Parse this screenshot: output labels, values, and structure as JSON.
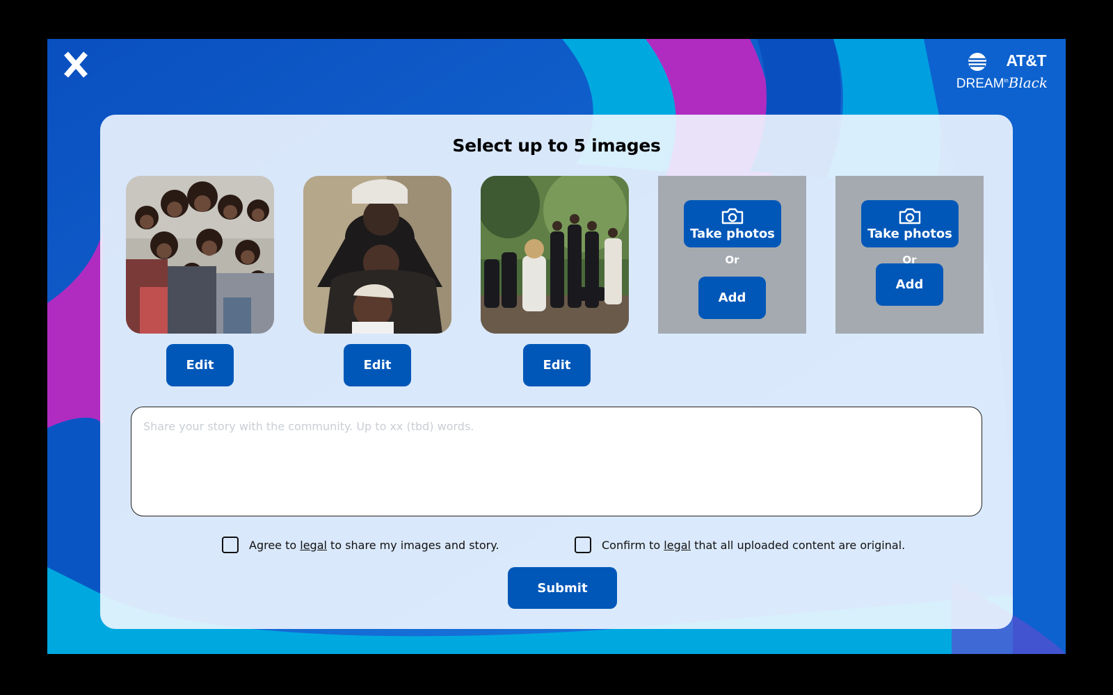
{
  "close_label": "X",
  "brand": {
    "att": "AT&T",
    "dream": "DREAM",
    "in": "in",
    "black": "Black"
  },
  "card": {
    "title": "Select up to 5 images"
  },
  "photos": [
    {
      "edit_label": "Edit"
    },
    {
      "edit_label": "Edit"
    },
    {
      "edit_label": "Edit"
    }
  ],
  "empty_slots": [
    {
      "take_label": "Take photos",
      "or_label": "Or",
      "add_label": "Add"
    },
    {
      "take_label": "Take photos",
      "or_label": "Or",
      "add_label": "Add"
    }
  ],
  "story": {
    "placeholder": "Share your story with the community. Up to xx (tbd) words."
  },
  "checks": [
    {
      "prefix": "Agree to ",
      "link": "legal",
      "suffix": " to share my images and story."
    },
    {
      "prefix": "Confirm to ",
      "link": "legal",
      "suffix": " that all uploaded content are original."
    }
  ],
  "submit_label": "Submit",
  "colors": {
    "primary": "#0057b8",
    "background_blue": "#0a5bc4",
    "accent_cyan": "#00a8e0",
    "accent_purple": "#b02cc1"
  }
}
